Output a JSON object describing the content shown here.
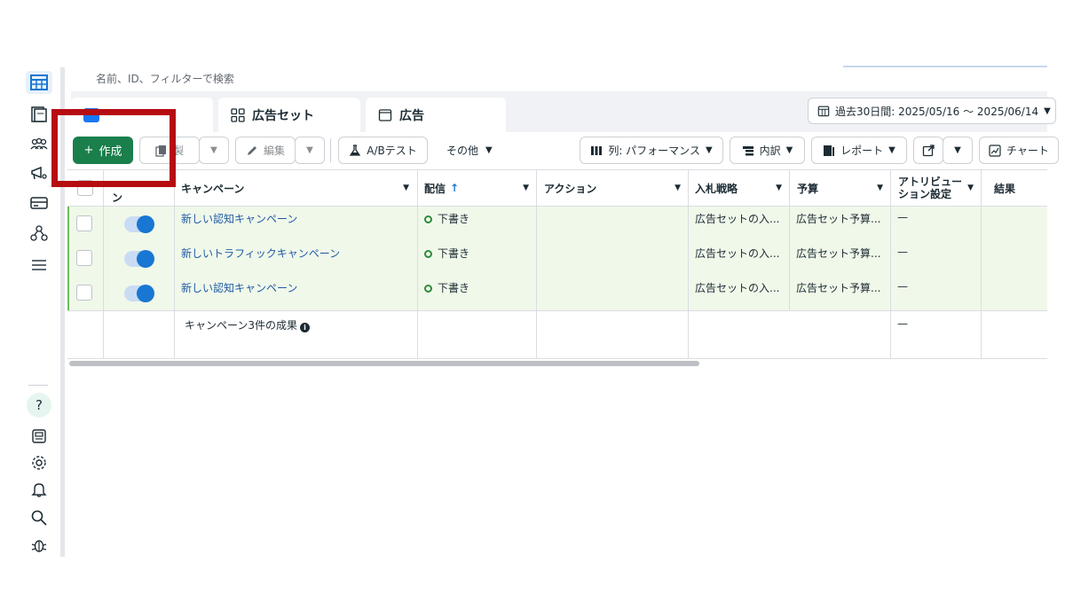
{
  "search": {
    "placeholder": "名前、ID、フィルターで検索"
  },
  "tabs": [
    {
      "label": ""
    },
    {
      "label": "広告セット"
    },
    {
      "label": "広告"
    }
  ],
  "date_range": "過去30日間: 2025/05/16 ～ 2025/06/14",
  "toolbar": {
    "create": "作成",
    "duplicate": "製",
    "edit": "編集",
    "ab_test": "A/Bテスト",
    "more": "その他",
    "columns": "列: パフォーマンス",
    "breakdown": "内訳",
    "reports": "レポート",
    "charts": "チャート"
  },
  "table": {
    "headers": {
      "toggle": "ン",
      "campaign": "キャンペーン",
      "delivery": "配信",
      "actions": "アクション",
      "bid_strategy": "入札戦略",
      "budget": "予算",
      "attribution": "アトリビュー\nション設定",
      "results": "結果"
    },
    "rows": [
      {
        "name": "新しい認知キャンペーン",
        "delivery": "下書き",
        "bid": "広告セットの入...",
        "budget": "広告セット予算...",
        "attribution": "—"
      },
      {
        "name": "新しいトラフィックキャンペーン",
        "delivery": "下書き",
        "bid": "広告セットの入...",
        "budget": "広告セット予算...",
        "attribution": "—"
      },
      {
        "name": "新しい認知キャンペーン",
        "delivery": "下書き",
        "bid": "広告セットの入...",
        "budget": "広告セット予算...",
        "attribution": "—"
      }
    ],
    "summary": {
      "label": "キャンペーン3件の成果",
      "attribution": "—"
    }
  },
  "rail": {
    "help": "?"
  },
  "colors": {
    "create_green": "#1a7f4b",
    "highlight_red": "#b50d12",
    "link_blue": "#1f5ba6"
  },
  "icons": [
    "table-icon",
    "pages-icon",
    "audience-icon",
    "megaphone-icon",
    "billing-icon",
    "network-icon",
    "menu-icon",
    "help-icon",
    "news-icon",
    "settings-icon",
    "bell-icon",
    "search-icon",
    "bug-icon"
  ]
}
